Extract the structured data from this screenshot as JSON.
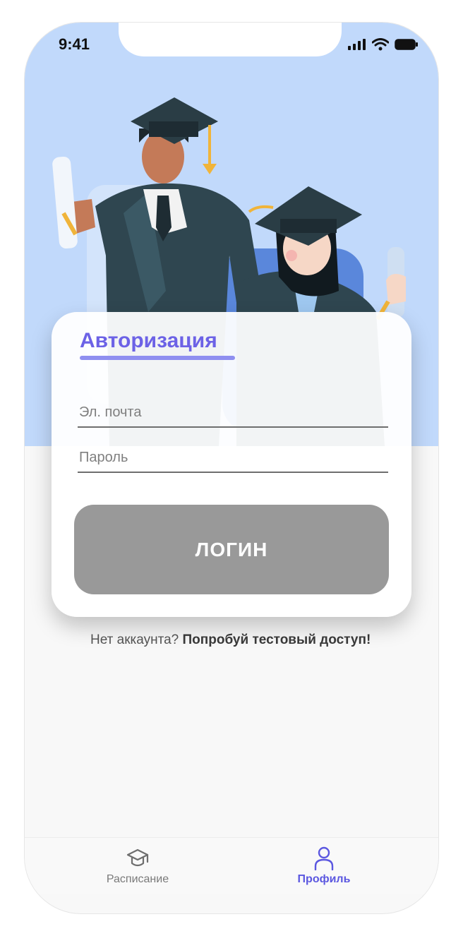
{
  "status_bar": {
    "time": "9:41"
  },
  "auth_card": {
    "title": "Авторизация",
    "email_placeholder": "Эл. почта",
    "password_placeholder": "Пароль",
    "login_label": "ЛОГИН"
  },
  "signup": {
    "prompt": "Нет аккаунта?",
    "link": "Попробуй тестовый доступ!"
  },
  "tabbar": {
    "items": [
      {
        "label": "Расписание",
        "icon": "graduation-cap-icon",
        "active": false
      },
      {
        "label": "Профиль",
        "icon": "user-icon",
        "active": true
      }
    ]
  },
  "colors": {
    "hero_bg": "#c1d9fb",
    "accent": "#6c62e6",
    "button_disabled": "#999999",
    "tab_active": "#5b57e0"
  }
}
